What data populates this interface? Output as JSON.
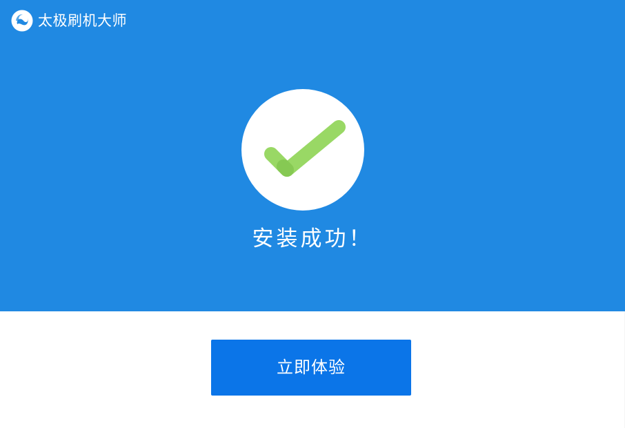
{
  "window": {
    "app_name": "太极刷机大师",
    "logo_icon": "taiji-logo-icon"
  },
  "hero": {
    "status_icon": "checkmark-icon",
    "status_text": "安装成功！"
  },
  "actions": {
    "primary_label": "立即体验"
  },
  "colors": {
    "hero_background": "#2089e2",
    "button_background": "#0b75e8",
    "check_green": "#99d865",
    "page_background": "#ffffff"
  }
}
